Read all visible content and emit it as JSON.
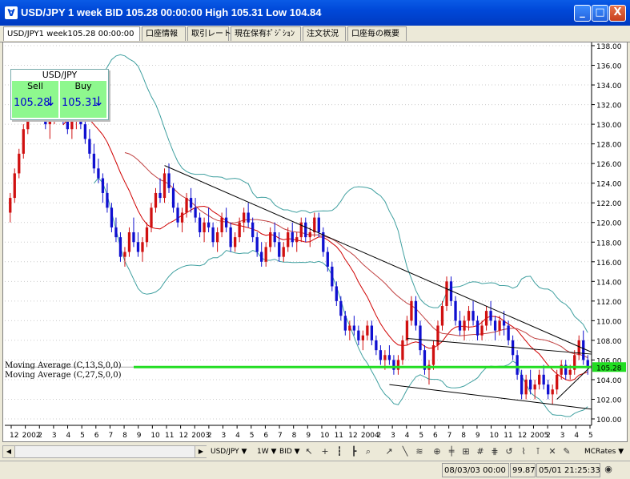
{
  "window": {
    "title": "USD/JPY 1 week BID 105.28 00:00:00 High 105.31 Low 104.84",
    "minimize": "_",
    "maximize": "□",
    "close": "X"
  },
  "tabs": [
    {
      "label": "USD/JPY1 week105.28 00:00:00"
    },
    {
      "label": "口座情報"
    },
    {
      "label": "取引レート"
    },
    {
      "label": "現在保有ﾎﾟｼﾞｼｮﾝ"
    },
    {
      "label": "注文状況"
    },
    {
      "label": "口座毎の概要"
    }
  ],
  "quote": {
    "symbol": "USD/JPY",
    "sell_label": "Sell",
    "buy_label": "Buy",
    "sell_value": "105.28",
    "buy_value": "105.31",
    "arrow": "↓"
  },
  "studies": [
    "Moving Average (C,13,S,0,0)",
    "Moving Average (C,27,S,0,0)"
  ],
  "current_price_label": "105.28",
  "colors": {
    "up": "#D01010",
    "down": "#1010D0",
    "ma13": "#D00000",
    "ma27": "#C04040",
    "bollinger": "#40A0A0",
    "priceline": "#22DD22",
    "trend": "#000000"
  },
  "chart_data": {
    "type": "candlestick",
    "y_ticks": [
      "138.00",
      "136.00",
      "134.00",
      "132.00",
      "130.00",
      "128.00",
      "126.00",
      "124.00",
      "122.00",
      "120.00",
      "118.00",
      "116.00",
      "114.00",
      "112.00",
      "110.00",
      "108.00",
      "106.00",
      "104.00",
      "102.00",
      "100.00"
    ],
    "ylim": [
      100,
      138
    ],
    "x_labels": [
      "12",
      "2002",
      "2",
      "3",
      "4",
      "5",
      "6",
      "7",
      "8",
      "9",
      "10",
      "11",
      "12",
      "2003",
      "2",
      "3",
      "4",
      "5",
      "6",
      "7",
      "8",
      "9",
      "10",
      "11",
      "12",
      "2004",
      "2",
      "3",
      "4",
      "5",
      "6",
      "7",
      "8",
      "9",
      "10",
      "11",
      "12",
      "2005",
      "2",
      "3",
      "4",
      "5"
    ],
    "bars": [
      [
        121.0,
        123.0,
        120.0,
        122.5
      ],
      [
        122.5,
        125.5,
        122.0,
        125.0
      ],
      [
        125.0,
        127.5,
        124.5,
        127.0
      ],
      [
        127.0,
        130.0,
        126.5,
        129.5
      ],
      [
        129.5,
        133.5,
        129.0,
        132.0
      ],
      [
        132.0,
        134.5,
        131.0,
        133.5
      ],
      [
        133.5,
        134.0,
        131.5,
        132.5
      ],
      [
        132.5,
        133.0,
        130.5,
        131.0
      ],
      [
        131.0,
        132.0,
        129.5,
        130.0
      ],
      [
        130.0,
        131.0,
        128.5,
        131.0
      ],
      [
        131.0,
        132.5,
        130.0,
        132.5
      ],
      [
        132.5,
        133.5,
        131.0,
        132.0
      ],
      [
        132.0,
        133.0,
        130.0,
        130.5
      ],
      [
        130.5,
        131.5,
        129.0,
        129.5
      ],
      [
        129.5,
        131.0,
        128.5,
        130.5
      ],
      [
        130.5,
        132.0,
        129.5,
        131.5
      ],
      [
        131.5,
        132.5,
        129.5,
        130.0
      ],
      [
        130.0,
        130.5,
        128.0,
        128.5
      ],
      [
        128.5,
        129.5,
        126.5,
        127.0
      ],
      [
        127.0,
        128.0,
        125.0,
        125.5
      ],
      [
        125.5,
        126.5,
        124.0,
        124.5
      ],
      [
        124.5,
        125.0,
        122.0,
        123.0
      ],
      [
        123.0,
        124.0,
        121.0,
        121.5
      ],
      [
        121.5,
        122.0,
        119.0,
        119.5
      ],
      [
        119.5,
        120.5,
        118.0,
        118.5
      ],
      [
        118.5,
        119.0,
        116.0,
        116.5
      ],
      [
        116.5,
        117.5,
        115.5,
        117.0
      ],
      [
        117.0,
        119.5,
        116.5,
        119.0
      ],
      [
        119.0,
        120.5,
        117.5,
        118.0
      ],
      [
        118.0,
        119.0,
        116.5,
        117.0
      ],
      [
        117.0,
        118.5,
        116.0,
        118.0
      ],
      [
        118.0,
        120.0,
        117.5,
        119.5
      ],
      [
        119.5,
        122.0,
        119.0,
        121.5
      ],
      [
        121.5,
        123.5,
        121.0,
        123.0
      ],
      [
        123.0,
        124.5,
        122.0,
        122.5
      ],
      [
        122.5,
        125.5,
        122.0,
        125.0
      ],
      [
        125.0,
        126.0,
        123.0,
        123.5
      ],
      [
        123.5,
        124.0,
        121.0,
        121.5
      ],
      [
        121.5,
        122.0,
        119.5,
        120.0
      ],
      [
        120.0,
        121.5,
        119.0,
        121.0
      ],
      [
        121.0,
        123.0,
        120.5,
        122.5
      ],
      [
        122.5,
        123.5,
        121.0,
        121.5
      ],
      [
        121.5,
        122.5,
        120.0,
        120.5
      ],
      [
        120.5,
        121.0,
        118.5,
        119.0
      ],
      [
        119.0,
        120.5,
        118.0,
        120.0
      ],
      [
        120.0,
        121.5,
        119.0,
        119.5
      ],
      [
        119.5,
        120.0,
        117.5,
        118.0
      ],
      [
        118.0,
        119.5,
        117.0,
        119.0
      ],
      [
        119.0,
        121.0,
        118.5,
        120.5
      ],
      [
        120.5,
        121.5,
        119.0,
        119.5
      ],
      [
        119.5,
        120.0,
        117.0,
        117.5
      ],
      [
        117.5,
        119.0,
        117.0,
        118.5
      ],
      [
        118.5,
        120.5,
        118.0,
        120.0
      ],
      [
        120.0,
        121.5,
        119.0,
        121.0
      ],
      [
        121.0,
        122.0,
        119.5,
        120.0
      ],
      [
        120.0,
        120.5,
        118.0,
        118.5
      ],
      [
        118.5,
        119.0,
        116.5,
        117.0
      ],
      [
        117.0,
        118.0,
        115.5,
        116.0
      ],
      [
        116.0,
        118.0,
        115.5,
        117.5
      ],
      [
        117.5,
        119.5,
        117.0,
        119.0
      ],
      [
        119.0,
        120.0,
        117.5,
        118.0
      ],
      [
        118.0,
        119.0,
        116.0,
        116.5
      ],
      [
        116.5,
        118.0,
        116.0,
        117.5
      ],
      [
        117.5,
        119.5,
        117.0,
        119.0
      ],
      [
        119.0,
        120.0,
        117.5,
        118.0
      ],
      [
        118.0,
        119.0,
        117.0,
        118.5
      ],
      [
        118.5,
        120.5,
        118.0,
        120.0
      ],
      [
        120.0,
        120.5,
        118.0,
        118.5
      ],
      [
        118.5,
        119.5,
        117.5,
        119.0
      ],
      [
        119.0,
        121.0,
        118.5,
        120.5
      ],
      [
        120.5,
        121.0,
        118.5,
        119.0
      ],
      [
        119.0,
        119.5,
        116.5,
        117.0
      ],
      [
        117.0,
        117.5,
        115.0,
        115.5
      ],
      [
        115.5,
        116.0,
        113.0,
        113.5
      ],
      [
        113.5,
        114.0,
        111.5,
        112.0
      ],
      [
        112.0,
        112.5,
        110.0,
        110.5
      ],
      [
        110.5,
        111.0,
        108.5,
        109.0
      ],
      [
        109.0,
        110.0,
        108.0,
        109.5
      ],
      [
        109.5,
        110.5,
        108.5,
        109.0
      ],
      [
        109.0,
        109.5,
        107.5,
        108.0
      ],
      [
        108.0,
        109.0,
        107.0,
        108.5
      ],
      [
        108.5,
        110.0,
        108.0,
        109.5
      ],
      [
        109.5,
        110.0,
        107.5,
        108.0
      ],
      [
        108.0,
        108.5,
        106.5,
        107.0
      ],
      [
        107.0,
        107.5,
        105.5,
        106.0
      ],
      [
        106.0,
        107.0,
        105.0,
        106.5
      ],
      [
        106.5,
        107.5,
        105.5,
        106.0
      ],
      [
        106.0,
        106.5,
        104.5,
        105.0
      ],
      [
        105.0,
        106.5,
        104.5,
        106.0
      ],
      [
        106.0,
        108.5,
        105.5,
        108.0
      ],
      [
        108.0,
        110.5,
        107.5,
        110.0
      ],
      [
        110.0,
        112.5,
        109.5,
        112.0
      ],
      [
        112.0,
        112.5,
        109.0,
        109.5
      ],
      [
        109.5,
        110.0,
        106.5,
        107.0
      ],
      [
        107.0,
        107.5,
        104.5,
        105.0
      ],
      [
        105.0,
        106.0,
        103.5,
        105.5
      ],
      [
        105.5,
        108.0,
        105.0,
        107.5
      ],
      [
        107.5,
        110.0,
        107.0,
        109.5
      ],
      [
        109.5,
        112.0,
        109.0,
        111.5
      ],
      [
        111.5,
        114.5,
        111.0,
        114.0
      ],
      [
        114.0,
        114.5,
        111.5,
        112.0
      ],
      [
        112.0,
        112.5,
        109.5,
        110.0
      ],
      [
        110.0,
        111.0,
        108.5,
        109.0
      ],
      [
        109.0,
        110.5,
        108.0,
        110.0
      ],
      [
        110.0,
        111.5,
        109.0,
        111.0
      ],
      [
        111.0,
        112.0,
        109.5,
        110.0
      ],
      [
        110.0,
        110.5,
        108.0,
        108.5
      ],
      [
        108.5,
        110.0,
        108.0,
        109.5
      ],
      [
        109.5,
        111.5,
        109.0,
        111.0
      ],
      [
        111.0,
        112.0,
        109.5,
        110.0
      ],
      [
        110.0,
        110.5,
        108.0,
        109.0
      ],
      [
        109.0,
        110.5,
        108.5,
        110.0
      ],
      [
        110.0,
        111.0,
        108.5,
        109.5
      ],
      [
        109.5,
        110.0,
        107.5,
        108.0
      ],
      [
        108.0,
        108.5,
        106.0,
        106.5
      ],
      [
        106.5,
        107.0,
        104.0,
        104.5
      ],
      [
        104.5,
        105.0,
        102.0,
        102.5
      ],
      [
        102.5,
        104.5,
        102.0,
        104.0
      ],
      [
        104.0,
        105.0,
        102.5,
        103.0
      ],
      [
        103.0,
        104.0,
        102.0,
        103.5
      ],
      [
        103.5,
        105.0,
        103.0,
        104.5
      ],
      [
        104.5,
        105.5,
        103.0,
        103.5
      ],
      [
        103.5,
        104.0,
        102.0,
        102.5
      ],
      [
        102.5,
        103.5,
        101.5,
        103.0
      ],
      [
        103.0,
        105.0,
        102.5,
        104.5
      ],
      [
        104.5,
        106.0,
        104.0,
        105.5
      ],
      [
        105.5,
        106.0,
        104.0,
        104.5
      ],
      [
        104.5,
        105.5,
        104.0,
        105.0
      ],
      [
        105.0,
        107.0,
        104.5,
        106.5
      ],
      [
        106.5,
        108.5,
        106.0,
        108.0
      ],
      [
        108.0,
        109.0,
        105.5,
        106.0
      ],
      [
        106.0,
        106.5,
        104.5,
        105.3
      ]
    ]
  },
  "toolbar": {
    "symbol": "USD/JPY ▼",
    "period": "1W ▼",
    "side": "BID ▼",
    "mcrates": "MCRates ▼"
  },
  "status": {
    "date_time": "08/03/03 00:00",
    "price": "99.87",
    "clock": "05/01 21:25:33"
  }
}
